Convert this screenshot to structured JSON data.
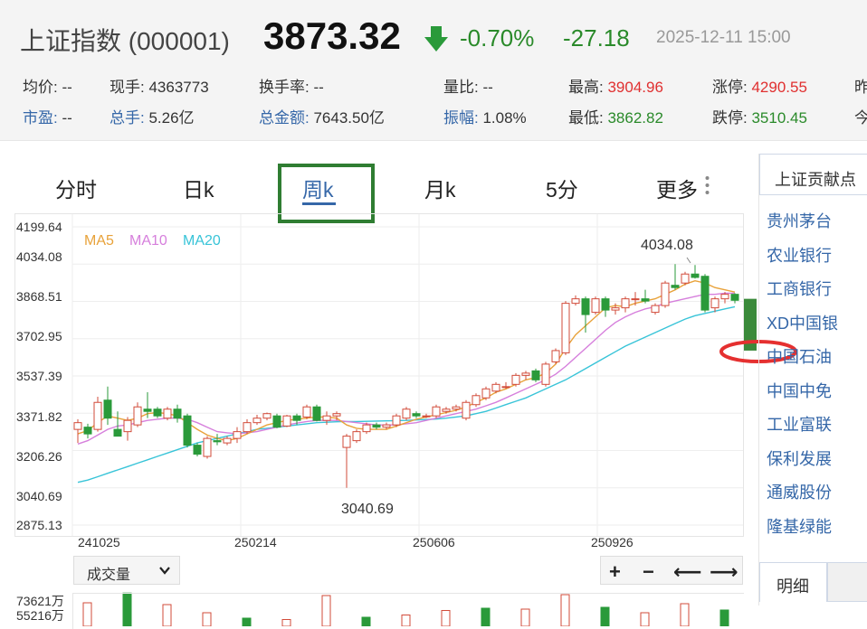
{
  "header": {
    "title": "上证指数 (000001)",
    "price": "3873.32",
    "change_pct": "-0.70%",
    "change": "-27.18",
    "datetime": "2025-12-11 15:00",
    "arrow_icon": "down-arrow-icon",
    "colors": {
      "down": "#2a8a2a",
      "up": "#e03030",
      "link": "#3567a8"
    }
  },
  "stats_row1": [
    {
      "label": "均价:",
      "value": "--"
    },
    {
      "label": "现手:",
      "value": "4363773"
    },
    {
      "label": "换手率:",
      "value": "--"
    },
    {
      "label": "量比:",
      "value": "--"
    },
    {
      "label": "最高:",
      "value": "3904.96"
    },
    {
      "label": "涨停:",
      "value": "4290.55"
    },
    {
      "label": "昨"
    }
  ],
  "stats_row2": [
    {
      "label": "市盈:",
      "value": "--"
    },
    {
      "label": "总手:",
      "value": "5.26亿"
    },
    {
      "label": "总金额:",
      "value": "7643.50亿"
    },
    {
      "label": "振幅:",
      "value": "1.08%"
    },
    {
      "label": "最低:",
      "value": "3862.82"
    },
    {
      "label": "跌停:",
      "value": "3510.45"
    },
    {
      "label": "今"
    }
  ],
  "tabs": [
    "分时",
    "日k",
    "周k",
    "月k",
    "5分",
    "更多"
  ],
  "active_tab": "周k",
  "chart": {
    "ma_labels": [
      {
        "label": "MA5",
        "color": "#e8a23a"
      },
      {
        "label": "MA10",
        "color": "#d67fdc"
      },
      {
        "label": "MA20",
        "color": "#38c4d8"
      }
    ],
    "y_ticks": [
      "4199.64",
      "4034.08",
      "3868.51",
      "3702.95",
      "3537.39",
      "3371.82",
      "3206.26",
      "3040.69",
      "2875.13"
    ],
    "x_ticks": [
      "241025",
      "250214",
      "250606",
      "250926"
    ],
    "high_label": "4034.08",
    "low_label": "3040.69"
  },
  "chart_data": {
    "type": "candlestick",
    "ylim": [
      2875.13,
      4199.64
    ],
    "candles": [
      {
        "o": 3300,
        "c": 3330,
        "h": 3345,
        "l": 3240
      },
      {
        "o": 3310,
        "c": 3280,
        "h": 3325,
        "l": 3260
      },
      {
        "o": 3300,
        "c": 3420,
        "h": 3445,
        "l": 3290
      },
      {
        "o": 3430,
        "c": 3350,
        "h": 3490,
        "l": 3320
      },
      {
        "o": 3300,
        "c": 3270,
        "h": 3380,
        "l": 3280
      },
      {
        "o": 3290,
        "c": 3340,
        "h": 3355,
        "l": 3250
      },
      {
        "o": 3320,
        "c": 3400,
        "h": 3420,
        "l": 3310
      },
      {
        "o": 3390,
        "c": 3380,
        "h": 3465,
        "l": 3350
      },
      {
        "o": 3390,
        "c": 3360,
        "h": 3400,
        "l": 3350
      },
      {
        "o": 3350,
        "c": 3390,
        "h": 3400,
        "l": 3340
      },
      {
        "o": 3390,
        "c": 3350,
        "h": 3410,
        "l": 3330
      },
      {
        "o": 3360,
        "c": 3230,
        "h": 3370,
        "l": 3220
      },
      {
        "o": 3230,
        "c": 3190,
        "h": 3240,
        "l": 3180
      },
      {
        "o": 3180,
        "c": 3260,
        "h": 3270,
        "l": 3170
      },
      {
        "o": 3250,
        "c": 3245,
        "h": 3280,
        "l": 3230
      },
      {
        "o": 3240,
        "c": 3260,
        "h": 3270,
        "l": 3230
      },
      {
        "o": 3260,
        "c": 3290,
        "h": 3310,
        "l": 3240
      },
      {
        "o": 3290,
        "c": 3330,
        "h": 3345,
        "l": 3280
      },
      {
        "o": 3330,
        "c": 3350,
        "h": 3365,
        "l": 3320
      },
      {
        "o": 3350,
        "c": 3370,
        "h": 3375,
        "l": 3340
      },
      {
        "o": 3360,
        "c": 3310,
        "h": 3370,
        "l": 3305
      },
      {
        "o": 3315,
        "c": 3360,
        "h": 3365,
        "l": 3310
      },
      {
        "o": 3360,
        "c": 3340,
        "h": 3370,
        "l": 3320
      },
      {
        "o": 3355,
        "c": 3400,
        "h": 3410,
        "l": 3345
      },
      {
        "o": 3400,
        "c": 3340,
        "h": 3410,
        "l": 3335
      },
      {
        "o": 3340,
        "c": 3360,
        "h": 3380,
        "l": 3320
      },
      {
        "o": 3360,
        "c": 3370,
        "h": 3380,
        "l": 3340
      },
      {
        "o": 3220,
        "c": 3270,
        "h": 3280,
        "l": 3040.69
      },
      {
        "o": 3250,
        "c": 3290,
        "h": 3300,
        "l": 3240
      },
      {
        "o": 3290,
        "c": 3320,
        "h": 3330,
        "l": 3280
      },
      {
        "o": 3320,
        "c": 3310,
        "h": 3330,
        "l": 3300
      },
      {
        "o": 3310,
        "c": 3320,
        "h": 3330,
        "l": 3300
      },
      {
        "o": 3320,
        "c": 3360,
        "h": 3370,
        "l": 3310
      },
      {
        "o": 3350,
        "c": 3390,
        "h": 3400,
        "l": 3340
      },
      {
        "o": 3370,
        "c": 3360,
        "h": 3380,
        "l": 3350
      },
      {
        "o": 3360,
        "c": 3360,
        "h": 3370,
        "l": 3350
      },
      {
        "o": 3360,
        "c": 3400,
        "h": 3410,
        "l": 3350
      },
      {
        "o": 3380,
        "c": 3390,
        "h": 3400,
        "l": 3370
      },
      {
        "o": 3390,
        "c": 3400,
        "h": 3410,
        "l": 3380
      },
      {
        "o": 3350,
        "c": 3420,
        "h": 3430,
        "l": 3340
      },
      {
        "o": 3410,
        "c": 3450,
        "h": 3460,
        "l": 3400
      },
      {
        "o": 3440,
        "c": 3480,
        "h": 3490,
        "l": 3430
      },
      {
        "o": 3470,
        "c": 3500,
        "h": 3510,
        "l": 3460
      },
      {
        "o": 3490,
        "c": 3490,
        "h": 3510,
        "l": 3480
      },
      {
        "o": 3500,
        "c": 3540,
        "h": 3550,
        "l": 3490
      },
      {
        "o": 3540,
        "c": 3550,
        "h": 3560,
        "l": 3520
      },
      {
        "o": 3560,
        "c": 3520,
        "h": 3570,
        "l": 3510
      },
      {
        "o": 3500,
        "c": 3590,
        "h": 3600,
        "l": 3490
      },
      {
        "o": 3600,
        "c": 3650,
        "h": 3660,
        "l": 3590
      },
      {
        "o": 3640,
        "c": 3860,
        "h": 3870,
        "l": 3630
      },
      {
        "o": 3860,
        "c": 3880,
        "h": 3895,
        "l": 3850
      },
      {
        "o": 3880,
        "c": 3810,
        "h": 3890,
        "l": 3730
      },
      {
        "o": 3820,
        "c": 3880,
        "h": 3890,
        "l": 3810
      },
      {
        "o": 3880,
        "c": 3830,
        "h": 3890,
        "l": 3800
      },
      {
        "o": 3830,
        "c": 3840,
        "h": 3860,
        "l": 3810
      },
      {
        "o": 3840,
        "c": 3880,
        "h": 3890,
        "l": 3820
      },
      {
        "o": 3880,
        "c": 3880,
        "h": 3910,
        "l": 3850
      },
      {
        "o": 3880,
        "c": 3870,
        "h": 3920,
        "l": 3860
      },
      {
        "o": 3820,
        "c": 3850,
        "h": 3860,
        "l": 3810
      },
      {
        "o": 3850,
        "c": 3950,
        "h": 3960,
        "l": 3840
      },
      {
        "o": 3940,
        "c": 3930,
        "h": 4034.08,
        "l": 3920
      },
      {
        "o": 3950,
        "c": 3990,
        "h": 4000,
        "l": 3940
      },
      {
        "o": 3990,
        "c": 3975,
        "h": 4030,
        "l": 3970
      },
      {
        "o": 3980,
        "c": 3830,
        "h": 3990,
        "l": 3820
      },
      {
        "o": 3840,
        "c": 3880,
        "h": 3890,
        "l": 3820
      },
      {
        "o": 3880,
        "c": 3900,
        "h": 3910,
        "l": 3860
      },
      {
        "o": 3900,
        "c": 3873.32,
        "h": 3905,
        "l": 3860
      }
    ],
    "ma5": [
      3280,
      3295,
      3330,
      3360,
      3350,
      3340,
      3350,
      3370,
      3375,
      3370,
      3360,
      3330,
      3300,
      3275,
      3260,
      3250,
      3260,
      3280,
      3300,
      3320,
      3330,
      3340,
      3345,
      3350,
      3355,
      3355,
      3350,
      3320,
      3305,
      3300,
      3300,
      3300,
      3315,
      3330,
      3345,
      3355,
      3365,
      3375,
      3385,
      3400,
      3420,
      3440,
      3465,
      3480,
      3500,
      3520,
      3530,
      3550,
      3590,
      3660,
      3720,
      3760,
      3800,
      3840,
      3850,
      3845,
      3860,
      3870,
      3880,
      3900,
      3920,
      3945,
      3960,
      3950,
      3930,
      3920,
      3910
    ],
    "ma10": [
      3235,
      3250,
      3275,
      3300,
      3315,
      3320,
      3330,
      3340,
      3345,
      3350,
      3350,
      3345,
      3330,
      3310,
      3290,
      3285,
      3280,
      3285,
      3290,
      3300,
      3310,
      3320,
      3328,
      3335,
      3340,
      3340,
      3340,
      3335,
      3330,
      3325,
      3320,
      3320,
      3320,
      3325,
      3330,
      3340,
      3350,
      3360,
      3370,
      3380,
      3390,
      3405,
      3420,
      3440,
      3460,
      3480,
      3500,
      3520,
      3545,
      3580,
      3620,
      3660,
      3700,
      3740,
      3775,
      3800,
      3820,
      3835,
      3845,
      3860,
      3870,
      3880,
      3890,
      3900,
      3900,
      3905,
      3905
    ],
    "ma20": [
      3065,
      3075,
      3090,
      3105,
      3120,
      3135,
      3150,
      3165,
      3180,
      3195,
      3210,
      3225,
      3240,
      3250,
      3260,
      3270,
      3280,
      3290,
      3300,
      3305,
      3310,
      3315,
      3320,
      3325,
      3330,
      3332,
      3334,
      3335,
      3335,
      3336,
      3337,
      3338,
      3339,
      3340,
      3342,
      3344,
      3346,
      3350,
      3355,
      3360,
      3370,
      3380,
      3395,
      3410,
      3425,
      3440,
      3460,
      3480,
      3500,
      3520,
      3545,
      3570,
      3595,
      3620,
      3645,
      3670,
      3690,
      3710,
      3730,
      3750,
      3770,
      3790,
      3805,
      3815,
      3825,
      3835,
      3845
    ]
  },
  "volume": {
    "selector": "成交量",
    "y_ticks": [
      "73621万",
      "55216万"
    ],
    "values": [
      52000,
      73621,
      48000,
      30000,
      18000,
      15000,
      68000,
      20000,
      25000,
      35000,
      40000,
      38000,
      70000,
      42000,
      30000,
      50000,
      36000
    ]
  },
  "controls": [
    "+",
    "−",
    "⟵",
    "⟶"
  ],
  "sidebar": {
    "header": "上证贡献点",
    "items": [
      "贵州茅台",
      "农业银行",
      "工商银行",
      "XD中国银",
      "中国石油",
      "中国中免",
      "工业富联",
      "保利发展",
      "通威股份",
      "隆基绿能"
    ],
    "detail_tab": "明细"
  },
  "annotations": {
    "box_color": "#2f7d32",
    "ellipse_color": "#e53030"
  }
}
